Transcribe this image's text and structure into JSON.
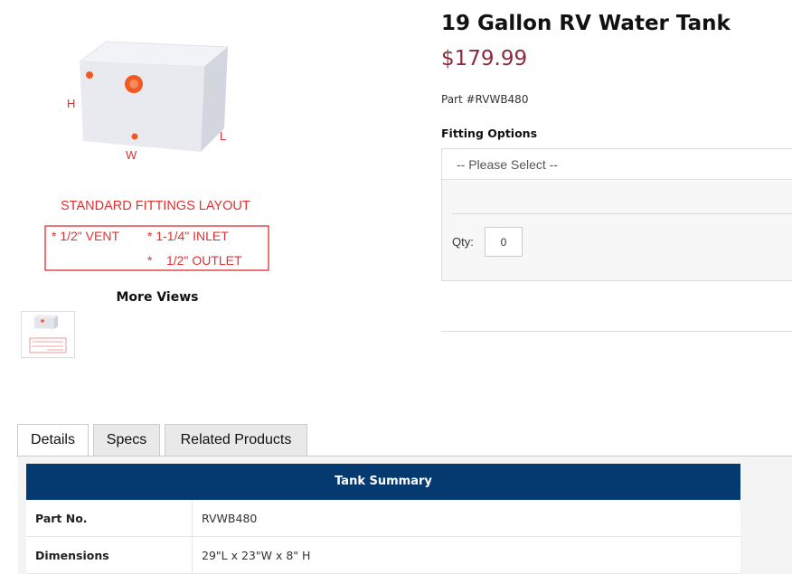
{
  "product": {
    "title": "19 Gallon RV Water Tank",
    "price": "$179.99",
    "part_number": "Part #RVWB480"
  },
  "image": {
    "dimension_labels": {
      "h": "H",
      "w": "W",
      "l": "L"
    },
    "layout_title": "STANDARD FITTINGS LAYOUT",
    "fittings": {
      "vent": "* 1/2\" VENT",
      "inlet": "* 1-1/4\" INLET",
      "outlet": "*    1/2\" OUTLET"
    },
    "fitting_color": "#e03030"
  },
  "more_views": {
    "title": "More Views"
  },
  "options": {
    "label": "Fitting Options",
    "select_value": "-- Please Select --",
    "qty_label": "Qty:",
    "qty_value": "0"
  },
  "tabs": [
    {
      "label": "Details",
      "active": true
    },
    {
      "label": "Specs",
      "active": false
    },
    {
      "label": "Related Products",
      "active": false
    }
  ],
  "summary": {
    "header": "Tank Summary",
    "rows": [
      {
        "key": "Part No.",
        "value": "RVWB480"
      },
      {
        "key": "Dimensions",
        "value": "29\"L x 23\"W x 8\" H"
      }
    ],
    "header_color": "#053a70"
  },
  "colors": {
    "price": "#8c2a3e"
  }
}
